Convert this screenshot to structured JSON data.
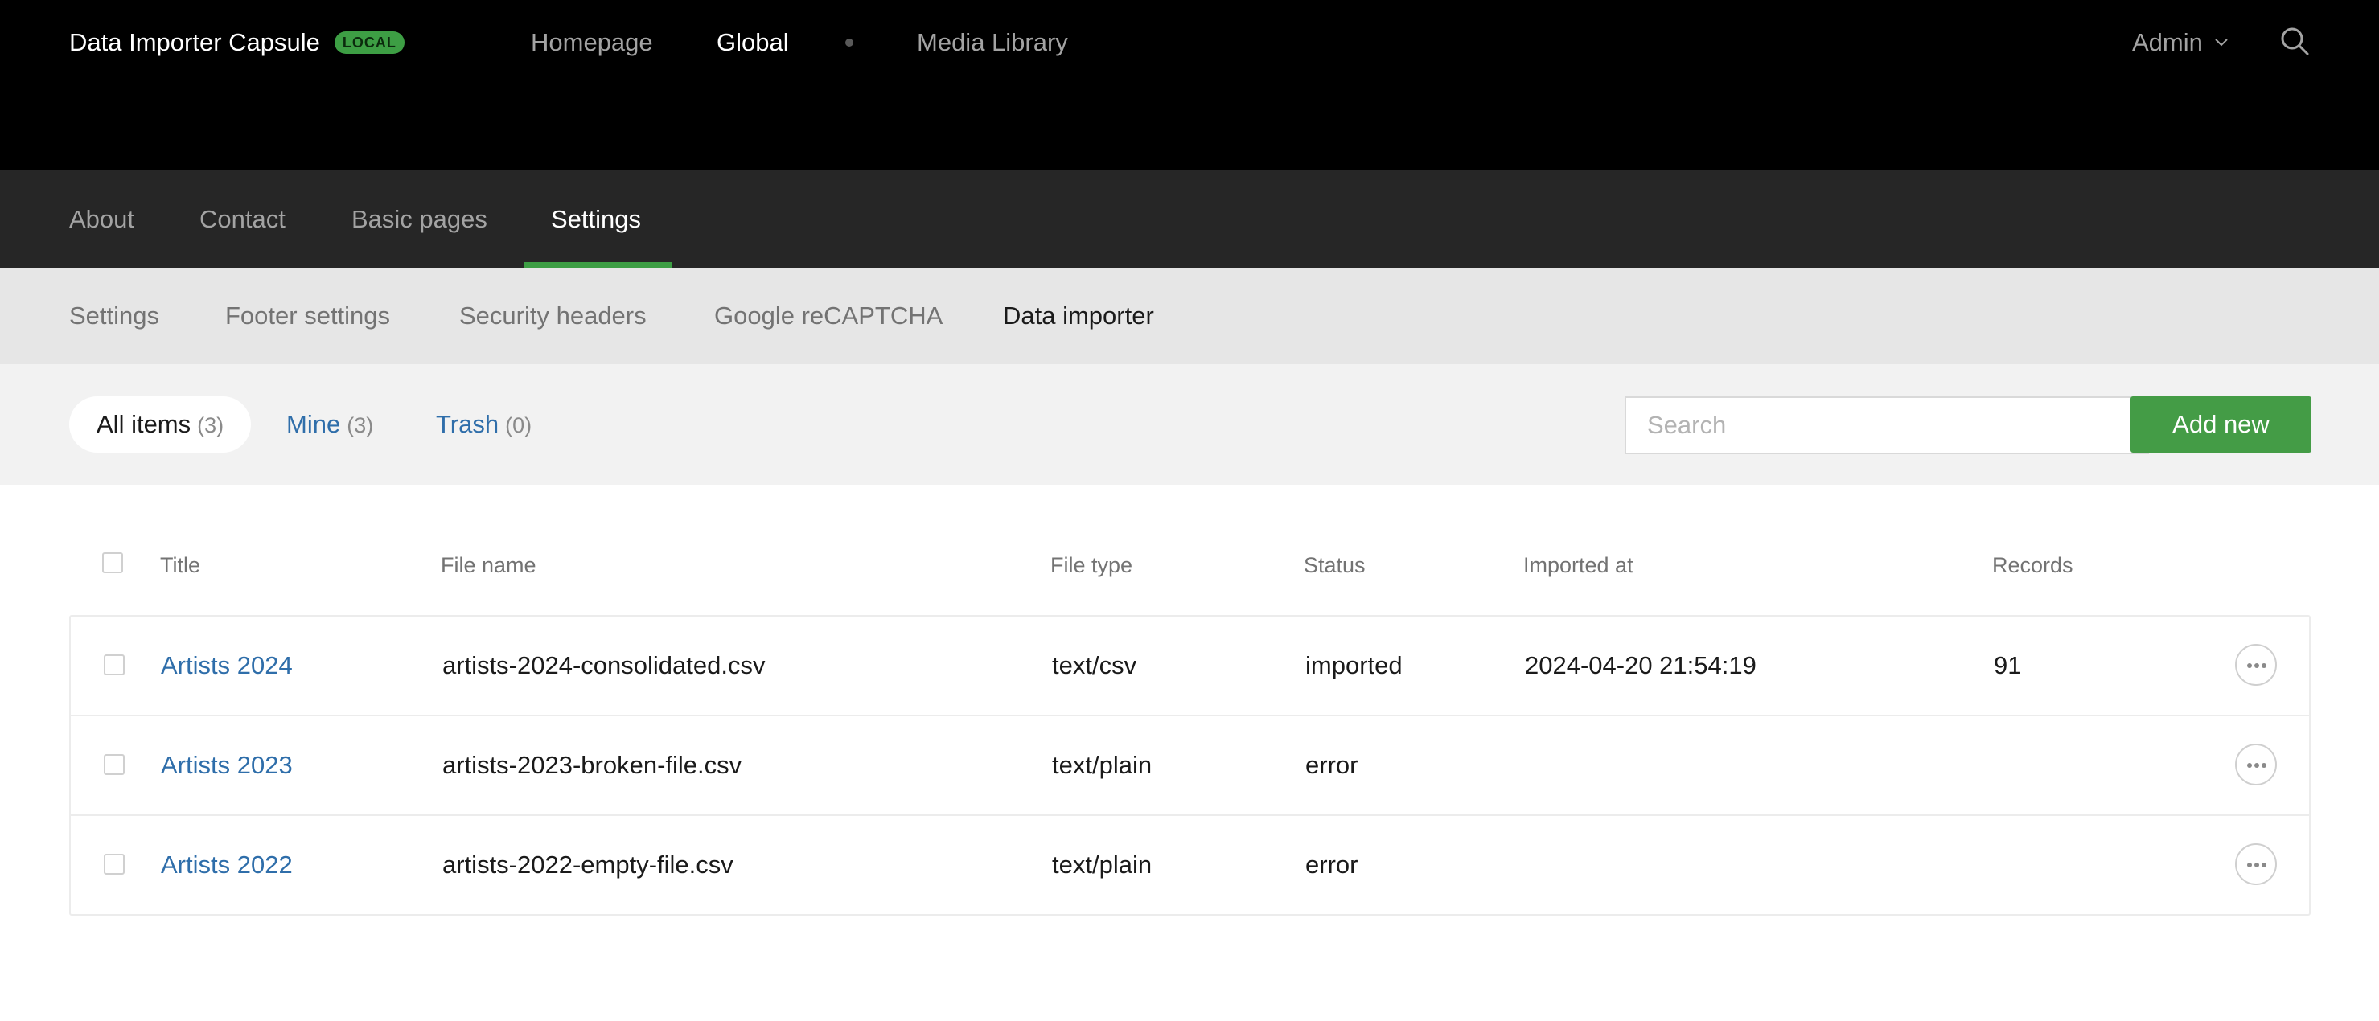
{
  "app": {
    "name": "Data Importer Capsule",
    "env_badge": "LOCAL"
  },
  "top_nav": {
    "items": [
      {
        "label": "Homepage",
        "active": false
      },
      {
        "label": "Global",
        "active": true
      },
      {
        "label": "Media Library",
        "active": false
      }
    ],
    "user_label": "Admin"
  },
  "section_tabs": [
    {
      "label": "About",
      "active": false
    },
    {
      "label": "Contact",
      "active": false
    },
    {
      "label": "Basic pages",
      "active": false
    },
    {
      "label": "Settings",
      "active": true
    }
  ],
  "sub_tabs": [
    {
      "label": "Settings",
      "active": false
    },
    {
      "label": "Footer settings",
      "active": false
    },
    {
      "label": "Security headers",
      "active": false
    },
    {
      "label": "Google reCAPTCHA",
      "active": false
    },
    {
      "label": "Data importer",
      "active": true
    }
  ],
  "filters": [
    {
      "label": "All items",
      "count": "(3)",
      "active": true
    },
    {
      "label": "Mine",
      "count": "(3)",
      "active": false
    },
    {
      "label": "Trash",
      "count": "(0)",
      "active": false
    }
  ],
  "search": {
    "placeholder": "Search",
    "value": ""
  },
  "add_button_label": "Add new",
  "table": {
    "columns": [
      "Title",
      "File name",
      "File type",
      "Status",
      "Imported at",
      "Records"
    ],
    "rows": [
      {
        "title": "Artists 2024",
        "file_name": "artists-2024-consolidated.csv",
        "file_type": "text/csv",
        "status": "imported",
        "imported_at": "2024-04-20 21:54:19",
        "records": "91"
      },
      {
        "title": "Artists 2023",
        "file_name": "artists-2023-broken-file.csv",
        "file_type": "text/plain",
        "status": "error",
        "imported_at": "",
        "records": ""
      },
      {
        "title": "Artists 2022",
        "file_name": "artists-2022-empty-file.csv",
        "file_type": "text/plain",
        "status": "error",
        "imported_at": "",
        "records": ""
      }
    ]
  },
  "colors": {
    "topbar_bg": "#000000",
    "section_bar_bg": "#262626",
    "accent_green": "#449c46",
    "link_blue": "#2f6eaa"
  },
  "icons": [
    "chevron-down-icon",
    "search-icon",
    "more-options-icon"
  ]
}
